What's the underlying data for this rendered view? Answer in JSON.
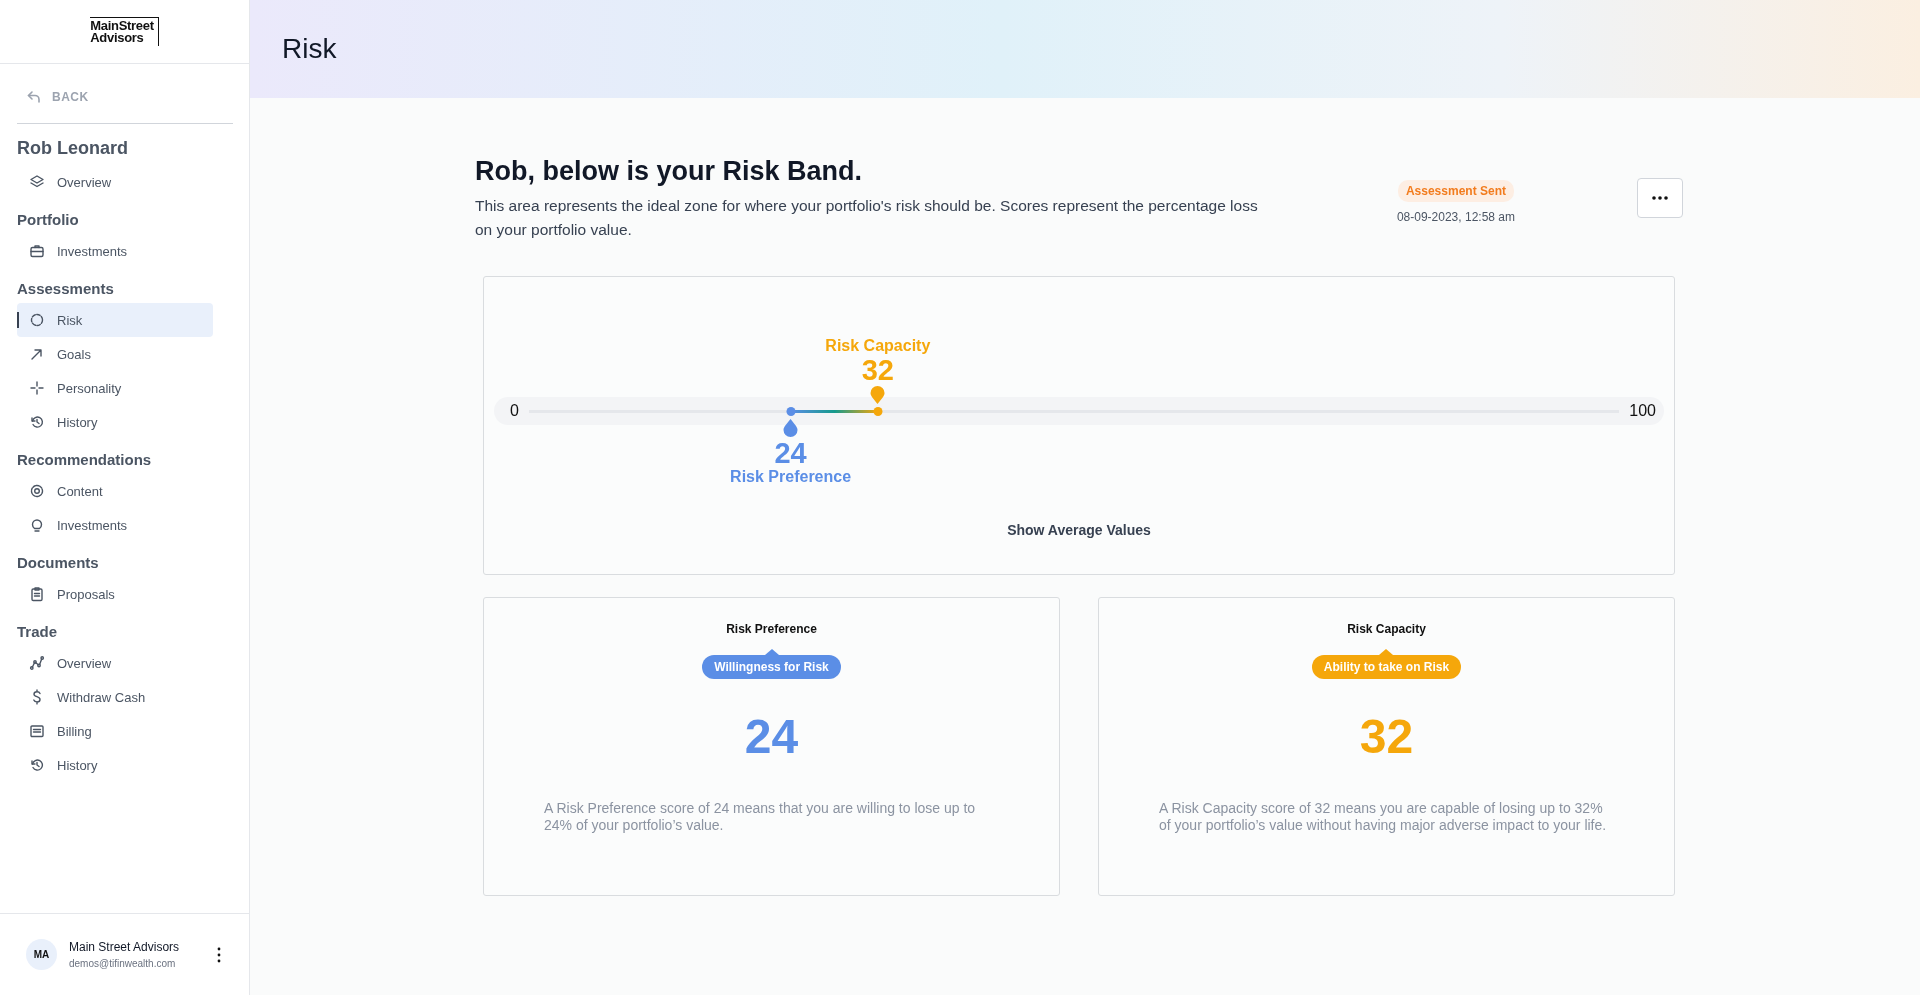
{
  "sidebar": {
    "logo": {
      "line_1": "MainStreet",
      "line_2": "Advisors"
    },
    "back": "BACK",
    "client_name": "Rob Leonard",
    "client_items": [
      {
        "label": "Overview",
        "selected": false
      }
    ],
    "sections": [
      {
        "title": "Portfolio",
        "items": [
          {
            "label": "Investments",
            "selected": false
          }
        ]
      },
      {
        "title": "Assessments",
        "items": [
          {
            "label": "Risk",
            "selected": true
          },
          {
            "label": "Goals",
            "selected": false
          },
          {
            "label": "Personality",
            "selected": false
          },
          {
            "label": "History",
            "selected": false
          }
        ]
      },
      {
        "title": "Recommendations",
        "items": [
          {
            "label": "Content",
            "selected": false
          },
          {
            "label": "Investments",
            "selected": false
          }
        ]
      },
      {
        "title": "Documents",
        "items": [
          {
            "label": "Proposals",
            "selected": false
          }
        ]
      },
      {
        "title": "Trade",
        "items": [
          {
            "label": "Overview",
            "selected": false
          },
          {
            "label": "Withdraw Cash",
            "selected": false
          },
          {
            "label": "Billing",
            "selected": false
          },
          {
            "label": "History",
            "selected": false
          }
        ]
      }
    ],
    "user": {
      "initials": "MA",
      "name": "Main Street Advisors",
      "email": "demos@tifinwealth.com"
    }
  },
  "page_title": "Risk",
  "intro": {
    "heading": "Rob, below is your Risk Band.",
    "description": "This area represents the ideal zone for where your portfolio's risk should be. Scores represent the percentage loss on your portfolio value.",
    "status": "Assessment Sent",
    "date": "08-09-2023, 12:58 am"
  },
  "band": {
    "min_label": "0",
    "max_label": "100",
    "markers": [
      {
        "kind": "below",
        "label": "Risk Preference",
        "value": "24",
        "level": 0.24,
        "color": "#5b8ee6"
      },
      {
        "kind": "above",
        "label": "Risk Capacity",
        "value": "32",
        "level": 0.32,
        "color": "#f5a70b"
      }
    ],
    "show_average": "Show Average Values"
  },
  "cards": [
    {
      "title": "Risk Preference",
      "tag": "Willingness for Risk",
      "value": "24",
      "color": "#5b8ee6",
      "description": "A Risk Preference score of 24 means that you are willing to lose up to 24% of your portfolio’s value."
    },
    {
      "title": "Risk Capacity",
      "tag": "Ability to take on Risk",
      "value": "32",
      "color": "#f5a70b",
      "description": "A Risk Capacity score of 32 means you are capable of losing up to 32% of your portfolio’s value without having major adverse impact to your life."
    }
  ]
}
